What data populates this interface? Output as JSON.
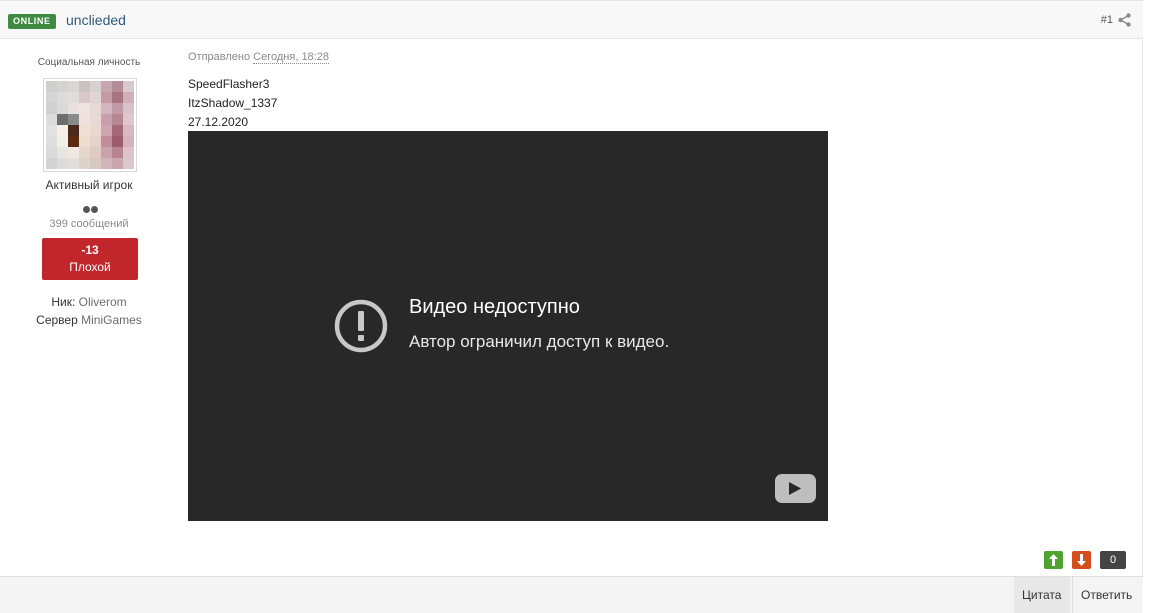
{
  "header": {
    "online_badge": "ONLINE",
    "author_name": "unclieded",
    "post_number": "#1",
    "share_icon": "share-icon"
  },
  "author": {
    "member_title": "Социальная личность",
    "group_name": "Активный игрок",
    "post_count": "399 сообщений",
    "reputation_value": "-13",
    "reputation_label": "Плохой",
    "nick_label": "Ник:",
    "nick_value": "Oliverom",
    "server_label": "Сервер",
    "server_value": "MiniGames",
    "reputation_color": "#c0262a"
  },
  "post": {
    "date_prefix": "Отправлено",
    "date_value": "Сегодня, 18:28",
    "lines": [
      "SpeedFlasher3",
      "ItzShadow_1337",
      "27.12.2020"
    ]
  },
  "video": {
    "title": "Видео недоступно",
    "subtitle": "Автор ограничил доступ к видео.",
    "icon": "exclamation-circle-icon",
    "logo": "youtube-logo-icon",
    "background_color": "#282828"
  },
  "votes": {
    "up_icon": "arrow-up-icon",
    "down_icon": "arrow-down-icon",
    "count": "0",
    "up_color": "#4fa32e",
    "down_color": "#d24f1d"
  },
  "footer": {
    "quote_label": "Цитата",
    "reply_label": "Ответить"
  }
}
